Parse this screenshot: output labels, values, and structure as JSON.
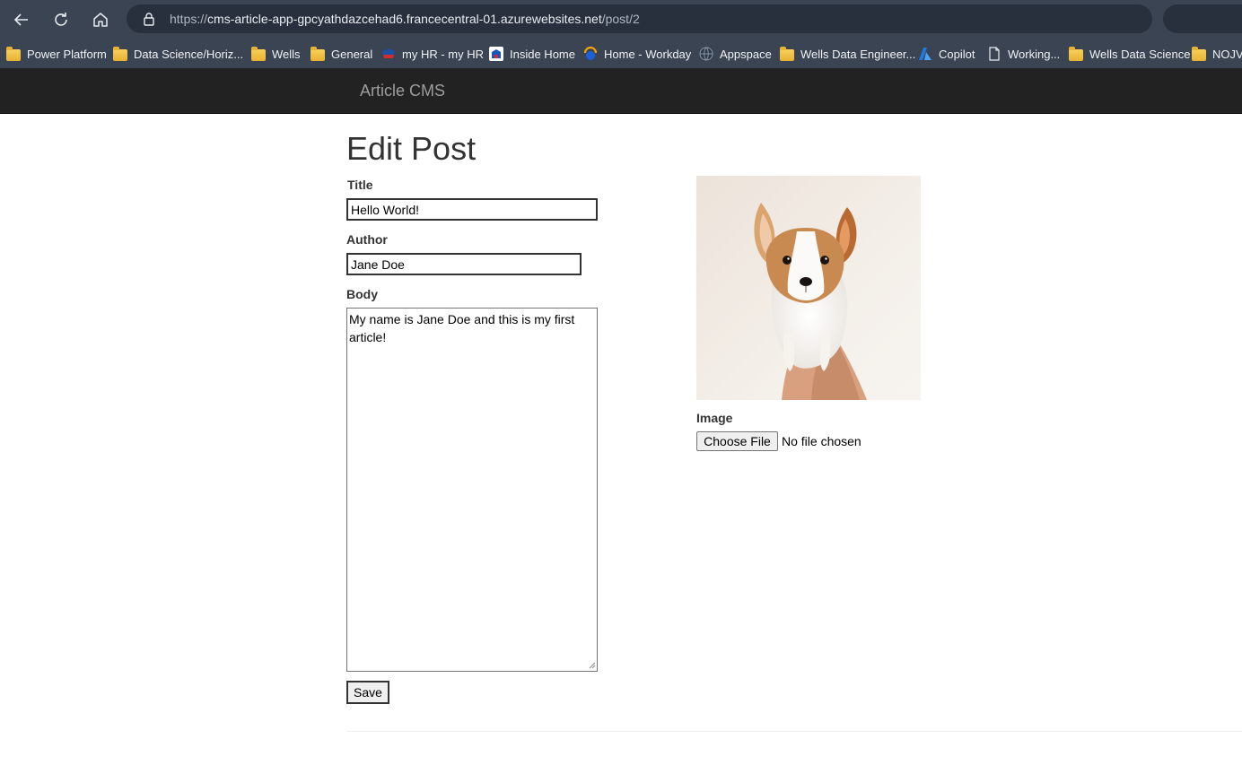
{
  "browser": {
    "url_protocol": "https://",
    "url_host": "cms-article-app-gpcyathdazcehad6.francecentral-01.azurewebsites.net",
    "url_path": "/post/2",
    "bookmarks": [
      {
        "label": "Power Platform",
        "icon": "folder-icon"
      },
      {
        "label": "Data Science/Horiz...",
        "icon": "folder-icon"
      },
      {
        "label": "Wells",
        "icon": "folder-icon"
      },
      {
        "label": "General",
        "icon": "folder-icon"
      },
      {
        "label": "my HR - my HR",
        "icon": "hr-icon"
      },
      {
        "label": "Inside Home",
        "icon": "inside-home-icon"
      },
      {
        "label": "Home - Workday",
        "icon": "workday-icon"
      },
      {
        "label": "Appspace",
        "icon": "globe-icon"
      },
      {
        "label": "Wells Data Engineer...",
        "icon": "folder-icon"
      },
      {
        "label": "Copilot",
        "icon": "azure-icon"
      },
      {
        "label": "Working...",
        "icon": "page-icon"
      },
      {
        "label": "Wells Data Science",
        "icon": "folder-icon"
      },
      {
        "label": "NOJV",
        "icon": "folder-icon"
      }
    ]
  },
  "navbar": {
    "brand": "Article CMS"
  },
  "form": {
    "heading": "Edit Post",
    "title_label": "Title",
    "title_value": "Hello World!",
    "author_label": "Author",
    "author_value": "Jane Doe",
    "body_label": "Body",
    "body_value": "My name is Jane Doe and this is my first article!",
    "save_label": "Save",
    "image_label": "Image",
    "choose_file_label": "Choose File",
    "no_file_text": "No file chosen"
  },
  "colors": {
    "chrome_bg": "#3b4452",
    "navbar_bg": "#222222",
    "brand_text": "#9d9d9d"
  }
}
